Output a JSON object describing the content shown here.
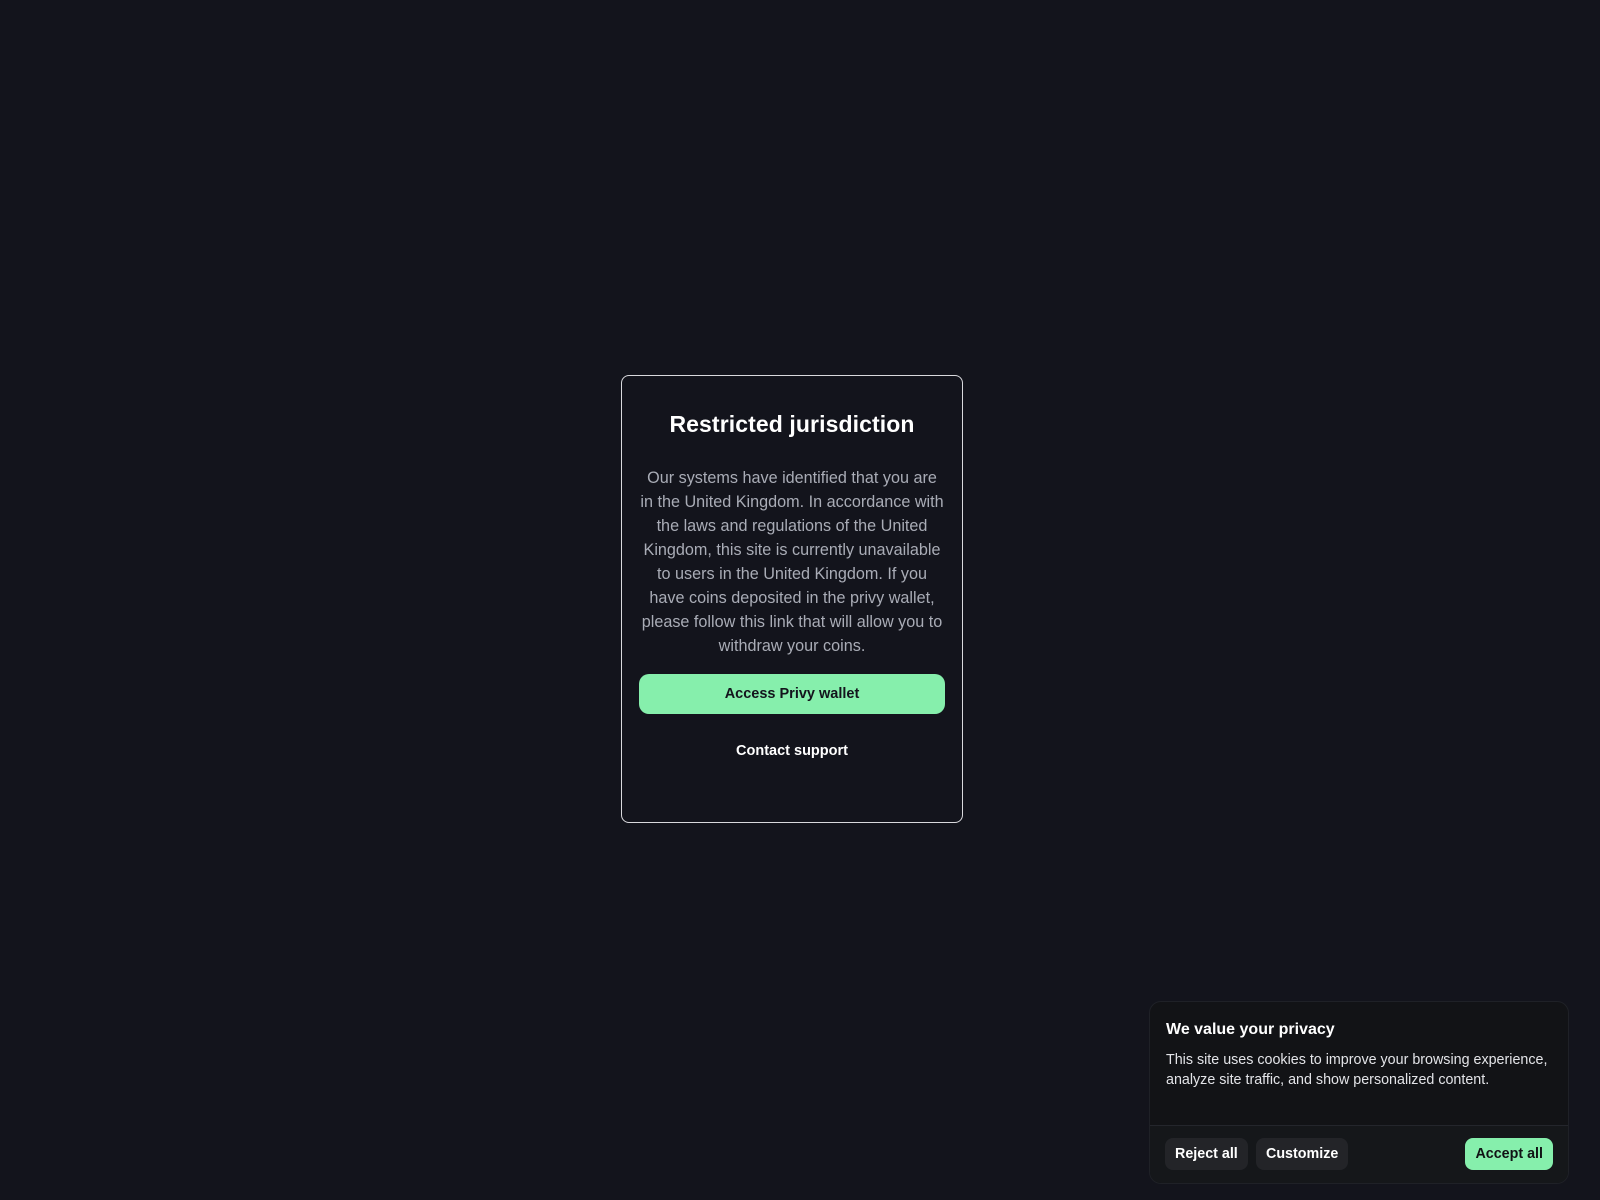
{
  "modal": {
    "title": "Restricted jurisdiction",
    "body": "Our systems have identified that you are in the United Kingdom. In accordance with the laws and regulations of the United Kingdom, this site is currently unavailable to users in the United Kingdom. If you have coins deposited in the privy wallet, please follow this link that will allow you to withdraw your coins.",
    "primary_button": "Access Privy wallet",
    "secondary_button": "Contact support"
  },
  "cookie_banner": {
    "title": "We value your privacy",
    "text": "This site uses cookies to improve your browsing experience, analyze site traffic, and show personalized content.",
    "reject_label": "Reject all",
    "customize_label": "Customize",
    "accept_label": "Accept all"
  },
  "colors": {
    "background": "#13141c",
    "accent": "#86efac",
    "modal_border": "#d9d9dd"
  }
}
